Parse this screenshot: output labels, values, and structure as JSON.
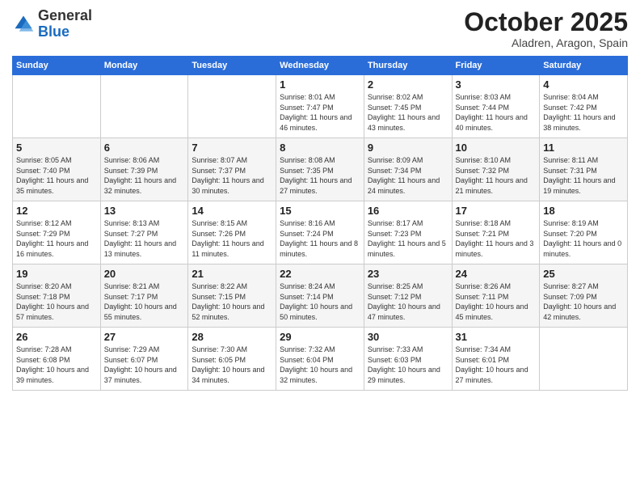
{
  "logo": {
    "general": "General",
    "blue": "Blue"
  },
  "title": "October 2025",
  "subtitle": "Aladren, Aragon, Spain",
  "days_header": [
    "Sunday",
    "Monday",
    "Tuesday",
    "Wednesday",
    "Thursday",
    "Friday",
    "Saturday"
  ],
  "weeks": [
    [
      {
        "day": "",
        "info": ""
      },
      {
        "day": "",
        "info": ""
      },
      {
        "day": "",
        "info": ""
      },
      {
        "day": "1",
        "info": "Sunrise: 8:01 AM\nSunset: 7:47 PM\nDaylight: 11 hours and 46 minutes."
      },
      {
        "day": "2",
        "info": "Sunrise: 8:02 AM\nSunset: 7:45 PM\nDaylight: 11 hours and 43 minutes."
      },
      {
        "day": "3",
        "info": "Sunrise: 8:03 AM\nSunset: 7:44 PM\nDaylight: 11 hours and 40 minutes."
      },
      {
        "day": "4",
        "info": "Sunrise: 8:04 AM\nSunset: 7:42 PM\nDaylight: 11 hours and 38 minutes."
      }
    ],
    [
      {
        "day": "5",
        "info": "Sunrise: 8:05 AM\nSunset: 7:40 PM\nDaylight: 11 hours and 35 minutes."
      },
      {
        "day": "6",
        "info": "Sunrise: 8:06 AM\nSunset: 7:39 PM\nDaylight: 11 hours and 32 minutes."
      },
      {
        "day": "7",
        "info": "Sunrise: 8:07 AM\nSunset: 7:37 PM\nDaylight: 11 hours and 30 minutes."
      },
      {
        "day": "8",
        "info": "Sunrise: 8:08 AM\nSunset: 7:35 PM\nDaylight: 11 hours and 27 minutes."
      },
      {
        "day": "9",
        "info": "Sunrise: 8:09 AM\nSunset: 7:34 PM\nDaylight: 11 hours and 24 minutes."
      },
      {
        "day": "10",
        "info": "Sunrise: 8:10 AM\nSunset: 7:32 PM\nDaylight: 11 hours and 21 minutes."
      },
      {
        "day": "11",
        "info": "Sunrise: 8:11 AM\nSunset: 7:31 PM\nDaylight: 11 hours and 19 minutes."
      }
    ],
    [
      {
        "day": "12",
        "info": "Sunrise: 8:12 AM\nSunset: 7:29 PM\nDaylight: 11 hours and 16 minutes."
      },
      {
        "day": "13",
        "info": "Sunrise: 8:13 AM\nSunset: 7:27 PM\nDaylight: 11 hours and 13 minutes."
      },
      {
        "day": "14",
        "info": "Sunrise: 8:15 AM\nSunset: 7:26 PM\nDaylight: 11 hours and 11 minutes."
      },
      {
        "day": "15",
        "info": "Sunrise: 8:16 AM\nSunset: 7:24 PM\nDaylight: 11 hours and 8 minutes."
      },
      {
        "day": "16",
        "info": "Sunrise: 8:17 AM\nSunset: 7:23 PM\nDaylight: 11 hours and 5 minutes."
      },
      {
        "day": "17",
        "info": "Sunrise: 8:18 AM\nSunset: 7:21 PM\nDaylight: 11 hours and 3 minutes."
      },
      {
        "day": "18",
        "info": "Sunrise: 8:19 AM\nSunset: 7:20 PM\nDaylight: 11 hours and 0 minutes."
      }
    ],
    [
      {
        "day": "19",
        "info": "Sunrise: 8:20 AM\nSunset: 7:18 PM\nDaylight: 10 hours and 57 minutes."
      },
      {
        "day": "20",
        "info": "Sunrise: 8:21 AM\nSunset: 7:17 PM\nDaylight: 10 hours and 55 minutes."
      },
      {
        "day": "21",
        "info": "Sunrise: 8:22 AM\nSunset: 7:15 PM\nDaylight: 10 hours and 52 minutes."
      },
      {
        "day": "22",
        "info": "Sunrise: 8:24 AM\nSunset: 7:14 PM\nDaylight: 10 hours and 50 minutes."
      },
      {
        "day": "23",
        "info": "Sunrise: 8:25 AM\nSunset: 7:12 PM\nDaylight: 10 hours and 47 minutes."
      },
      {
        "day": "24",
        "info": "Sunrise: 8:26 AM\nSunset: 7:11 PM\nDaylight: 10 hours and 45 minutes."
      },
      {
        "day": "25",
        "info": "Sunrise: 8:27 AM\nSunset: 7:09 PM\nDaylight: 10 hours and 42 minutes."
      }
    ],
    [
      {
        "day": "26",
        "info": "Sunrise: 7:28 AM\nSunset: 6:08 PM\nDaylight: 10 hours and 39 minutes."
      },
      {
        "day": "27",
        "info": "Sunrise: 7:29 AM\nSunset: 6:07 PM\nDaylight: 10 hours and 37 minutes."
      },
      {
        "day": "28",
        "info": "Sunrise: 7:30 AM\nSunset: 6:05 PM\nDaylight: 10 hours and 34 minutes."
      },
      {
        "day": "29",
        "info": "Sunrise: 7:32 AM\nSunset: 6:04 PM\nDaylight: 10 hours and 32 minutes."
      },
      {
        "day": "30",
        "info": "Sunrise: 7:33 AM\nSunset: 6:03 PM\nDaylight: 10 hours and 29 minutes."
      },
      {
        "day": "31",
        "info": "Sunrise: 7:34 AM\nSunset: 6:01 PM\nDaylight: 10 hours and 27 minutes."
      },
      {
        "day": "",
        "info": ""
      }
    ]
  ]
}
